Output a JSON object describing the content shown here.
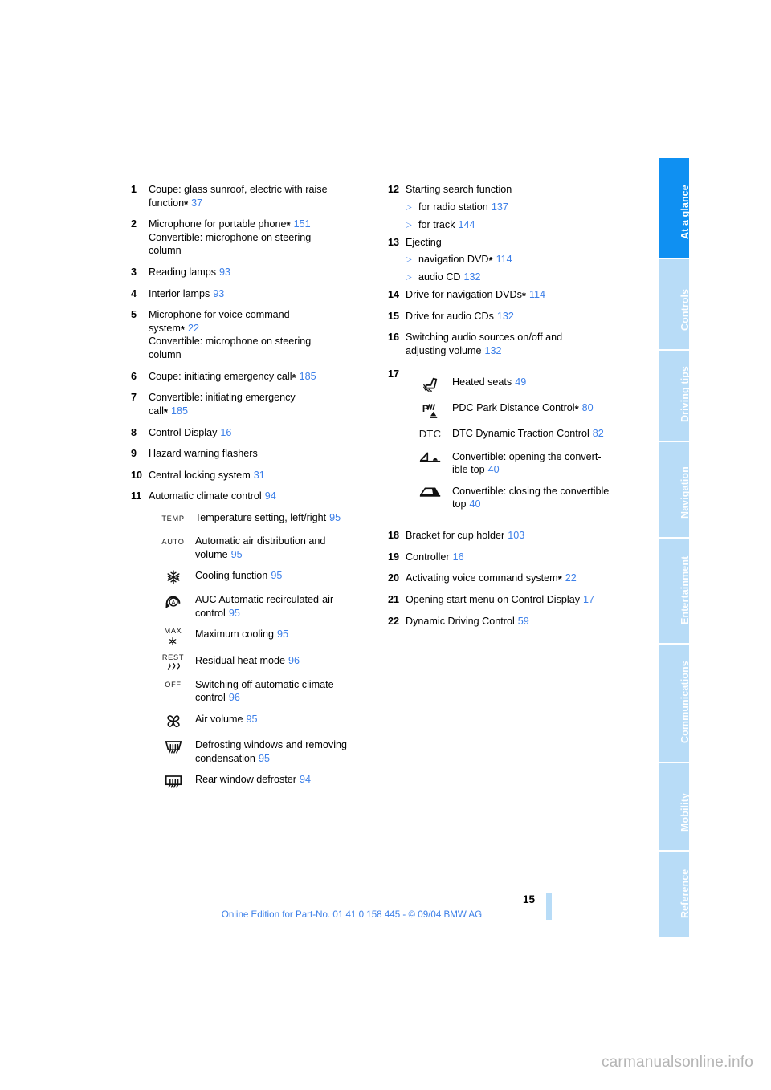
{
  "page": {
    "number": "15",
    "footer_note": "Online Edition for Part-No. 01 41 0 158 445 - © 09/04 BMW AG",
    "watermark": "carmanualsonline.info"
  },
  "sidebar": {
    "tabs": [
      {
        "label": "At a glance",
        "active": true
      },
      {
        "label": "Controls",
        "active": false
      },
      {
        "label": "Driving tips",
        "active": false
      },
      {
        "label": "Navigation",
        "active": false
      },
      {
        "label": "Entertainment",
        "active": false
      },
      {
        "label": "Communications",
        "active": false
      },
      {
        "label": "Mobility",
        "active": false
      },
      {
        "label": "Reference",
        "active": false
      }
    ],
    "active_color": "#0f90f2",
    "inactive_color": "#b8dcf7"
  },
  "left_column": {
    "items": [
      {
        "num": "1",
        "line1": "Coupe: glass sunroof, electric with raise",
        "line2": "function",
        "star": "*",
        "ref": "37"
      },
      {
        "num": "2",
        "line1": "Microphone for portable phone",
        "star": "*",
        "ref": "151",
        "line2": "Convertible: microphone on steering",
        "line3": "column"
      },
      {
        "num": "3",
        "line1": "Reading lamps",
        "ref": "93"
      },
      {
        "num": "4",
        "line1": "Interior lamps",
        "ref": "93"
      },
      {
        "num": "5",
        "line1": "Microphone for voice command",
        "line2": "system",
        "star": "*",
        "ref": "22",
        "line3": "Convertible: microphone on steering",
        "line4": "column"
      },
      {
        "num": "6",
        "line1": "Coupe: initiating emergency call",
        "star": "*",
        "ref": "185"
      },
      {
        "num": "7",
        "line1": "Convertible: initiating emergency",
        "line2": "call",
        "star": "*",
        "ref": "185"
      },
      {
        "num": "8",
        "line1": "Control Display",
        "ref": "16"
      },
      {
        "num": "9",
        "line1": "Hazard warning flashers",
        "ref": ""
      },
      {
        "num": "10",
        "line1": "Central locking system",
        "ref": "31"
      },
      {
        "num": "11",
        "line1": "Automatic climate control",
        "ref": "94"
      }
    ],
    "climate_icons": [
      {
        "icon": "temp-icon",
        "glyph": "TEMP",
        "text": "Temperature setting, left/right",
        "ref": "95"
      },
      {
        "icon": "auto-icon",
        "glyph": "AUTO",
        "text_line1": "Automatic air distribution and",
        "text_line2": "volume",
        "ref": "95"
      },
      {
        "icon": "snowflake-icon",
        "glyph": "",
        "text": "Cooling function",
        "ref": "95"
      },
      {
        "icon": "auc-recirculation-icon",
        "glyph": "",
        "text_line1": "AUC Automatic recirculated-air",
        "text_line2": "control",
        "ref": "95"
      },
      {
        "icon": "max-cooling-icon",
        "glyph": "MAX",
        "text": "Maximum cooling",
        "ref": "95"
      },
      {
        "icon": "residual-heat-icon",
        "glyph": "REST",
        "text": "Residual heat mode",
        "ref": "96"
      },
      {
        "icon": "off-icon",
        "glyph": "OFF",
        "text_line1": "Switching off automatic climate",
        "text_line2": "control",
        "ref": "96"
      },
      {
        "icon": "fan-icon",
        "glyph": "",
        "text": "Air volume",
        "ref": "95"
      },
      {
        "icon": "windshield-defrost-icon",
        "glyph": "",
        "text_line1": "Defrosting windows and removing",
        "text_line2": "condensation",
        "ref": "95"
      },
      {
        "icon": "rear-defroster-icon",
        "glyph": "",
        "text": "Rear window defroster",
        "ref": "94"
      }
    ]
  },
  "right_column": {
    "items_top": [
      {
        "num": "12",
        "line1": "Starting search function",
        "ref": ""
      },
      {
        "num": "13",
        "line1": "Ejecting",
        "ref": ""
      },
      {
        "num": "14",
        "line1": "Drive for navigation DVDs",
        "star": "*",
        "ref": "114"
      },
      {
        "num": "15",
        "line1": "Drive for audio CDs",
        "ref": "132"
      },
      {
        "num": "16",
        "line1": "Switching audio sources on/off and",
        "line2": "adjusting volume",
        "ref": "132"
      }
    ],
    "sub_12": [
      {
        "text": "for radio station",
        "ref": "137"
      },
      {
        "text": "for track",
        "ref": "144"
      }
    ],
    "sub_13": [
      {
        "text": "navigation DVD",
        "star": "*",
        "ref": "114"
      },
      {
        "text": "audio CD",
        "ref": "132"
      }
    ],
    "item17": {
      "num": "17",
      "icons": [
        {
          "icon": "heated-seat-icon",
          "glyph": "",
          "text": "Heated seats",
          "ref": "49"
        },
        {
          "icon": "pdc-icon",
          "glyph": "",
          "text": "PDC Park Distance Control",
          "star": "*",
          "ref": "80"
        },
        {
          "icon": "dtc-icon",
          "glyph": "DTC",
          "text": "DTC Dynamic Traction Control",
          "ref": "82"
        },
        {
          "icon": "convertible-top-open-icon",
          "glyph": "",
          "text_line1": "Convertible: opening the convert-",
          "text_line2": "ible top",
          "ref": "40"
        },
        {
          "icon": "convertible-top-close-icon",
          "glyph": "",
          "text_line1": "Convertible: closing the convertible",
          "text_line2": "top",
          "ref": "40"
        }
      ]
    },
    "items_bottom": [
      {
        "num": "18",
        "line1": "Bracket for cup holder",
        "ref": "103"
      },
      {
        "num": "19",
        "line1": "Controller",
        "ref": "16"
      },
      {
        "num": "20",
        "line1": "Activating voice command system",
        "star": "*",
        "ref": "22"
      },
      {
        "num": "21",
        "line1": "Opening start menu on Control Display",
        "ref": "17"
      },
      {
        "num": "22",
        "line1": "Dynamic Driving Control",
        "ref": "59"
      }
    ]
  },
  "colors": {
    "link_blue": "#3c7fe8",
    "tab_active": "#0f90f2",
    "tab_inactive": "#b8dcf7",
    "watermark_gray": "#b5b5b5"
  }
}
